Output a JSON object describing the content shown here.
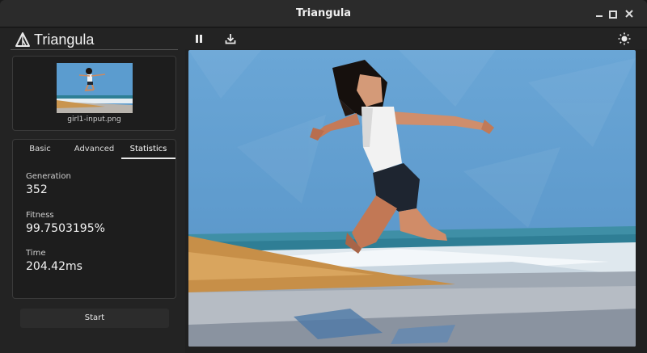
{
  "window": {
    "title": "Triangula"
  },
  "brand": {
    "name": "Triangula",
    "logo_icon": "triangle-logo-icon"
  },
  "input_image": {
    "filename": "girl1-input.png"
  },
  "tabs": [
    {
      "label": "Basic"
    },
    {
      "label": "Advanced"
    },
    {
      "label": "Statistics"
    }
  ],
  "active_tab": "Statistics",
  "stats": {
    "generation_label": "Generation",
    "generation_value": "352",
    "fitness_label": "Fitness",
    "fitness_value": "99.7503195%",
    "time_label": "Time",
    "time_value": "204.42ms"
  },
  "actions": {
    "start_label": "Start"
  },
  "toolbar": {
    "pause_icon": "pause-icon",
    "download_icon": "download-icon",
    "theme_icon": "brightness-icon"
  },
  "colors": {
    "sky": "#5b9ccf",
    "sand": "#c9954f",
    "sea": "#2e7f95",
    "foam": "#e6eef3",
    "accent": "#e8e8e8"
  }
}
